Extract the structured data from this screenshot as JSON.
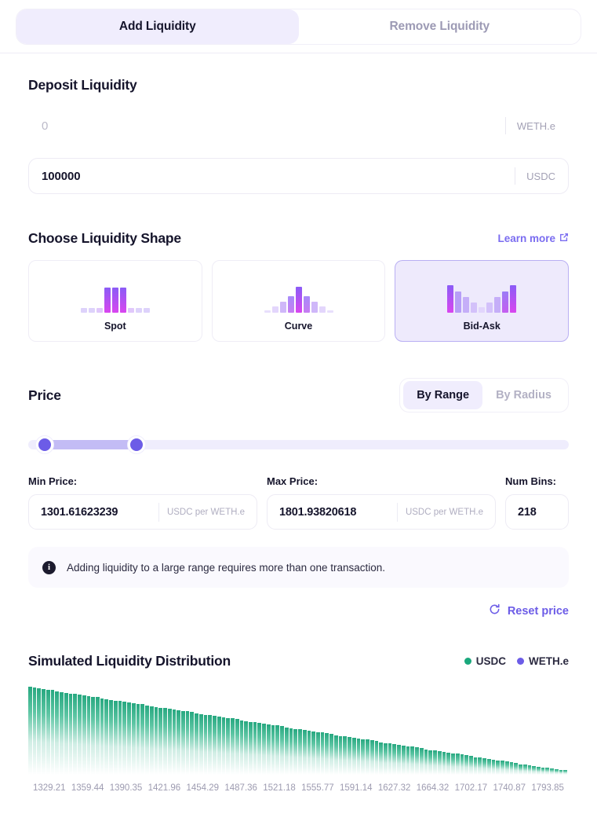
{
  "tabs": [
    {
      "label": "Add Liquidity",
      "active": true
    },
    {
      "label": "Remove Liquidity",
      "active": false
    }
  ],
  "deposit": {
    "title": "Deposit Liquidity",
    "rows": [
      {
        "value": "0",
        "is_placeholder": true,
        "unit": "WETH.e"
      },
      {
        "value": "100000",
        "is_placeholder": false,
        "unit": "USDC"
      }
    ]
  },
  "shape": {
    "title": "Choose Liquidity Shape",
    "learn_more": "Learn more",
    "learn_more_icon": "external-link-icon",
    "options": [
      {
        "label": "Spot",
        "selected": false
      },
      {
        "label": "Curve",
        "selected": false
      },
      {
        "label": "Bid-Ask",
        "selected": true
      }
    ]
  },
  "price": {
    "title": "Price",
    "modes": [
      {
        "label": "By Range",
        "active": true
      },
      {
        "label": "By Radius",
        "active": false
      }
    ],
    "slider": {
      "left_pct": 1.5,
      "right_pct": 18.5
    },
    "min": {
      "label": "Min Price:",
      "value": "1301.61623239",
      "unit": "USDC per WETH.e"
    },
    "max": {
      "label": "Max Price:",
      "value": "1801.93820618",
      "unit": "USDC per WETH.e"
    },
    "bins": {
      "label": "Num Bins:",
      "value": "218"
    },
    "info_icon": "info-icon",
    "info": "Adding liquidity to a large range requires more than one transaction.",
    "reset_icon": "refresh-icon",
    "reset": "Reset price"
  },
  "chart_data": {
    "type": "bar",
    "title": "Simulated Liquidity Distribution",
    "xlabel": "",
    "ylabel": "",
    "grid": false,
    "legend_position": "top-right",
    "legend": [
      {
        "name": "USDC",
        "color": "#1aa87c"
      },
      {
        "name": "WETH.e",
        "color": "#6c5ce7"
      }
    ],
    "tick_labels": [
      "1329.21",
      "1359.44",
      "1390.35",
      "1421.96",
      "1454.29",
      "1487.36",
      "1521.18",
      "1555.77",
      "1591.14",
      "1627.32",
      "1664.32",
      "1702.17",
      "1740.87",
      "1793.85"
    ],
    "xlim": [
      1301.61623239,
      1801.93820618
    ],
    "series": [
      {
        "name": "USDC",
        "color": "#1aa87c",
        "values": [
          100,
          99,
          98,
          97,
          96,
          96,
          95,
          94,
          93,
          92,
          92,
          91,
          90,
          89,
          88,
          88,
          87,
          86,
          85,
          84,
          84,
          83,
          82,
          81,
          80,
          80,
          79,
          78,
          77,
          76,
          76,
          75,
          74,
          73,
          72,
          72,
          71,
          70,
          69,
          68,
          68,
          67,
          66,
          65,
          64,
          64,
          63,
          62,
          61,
          60,
          60,
          59,
          58,
          57,
          56,
          56,
          55,
          54,
          53,
          52,
          52,
          51,
          50,
          49,
          48,
          48,
          47,
          46,
          45,
          44,
          44,
          43,
          42,
          41,
          40,
          40,
          39,
          38,
          37,
          36,
          36,
          35,
          34,
          33,
          32,
          32,
          31,
          30,
          29,
          28,
          28,
          27,
          26,
          25,
          24,
          24,
          23,
          22,
          21,
          20,
          20,
          19,
          18,
          17,
          16,
          16,
          15,
          14,
          13,
          12,
          12,
          11,
          10,
          9,
          8,
          8,
          7,
          6,
          5,
          5
        ]
      }
    ]
  }
}
